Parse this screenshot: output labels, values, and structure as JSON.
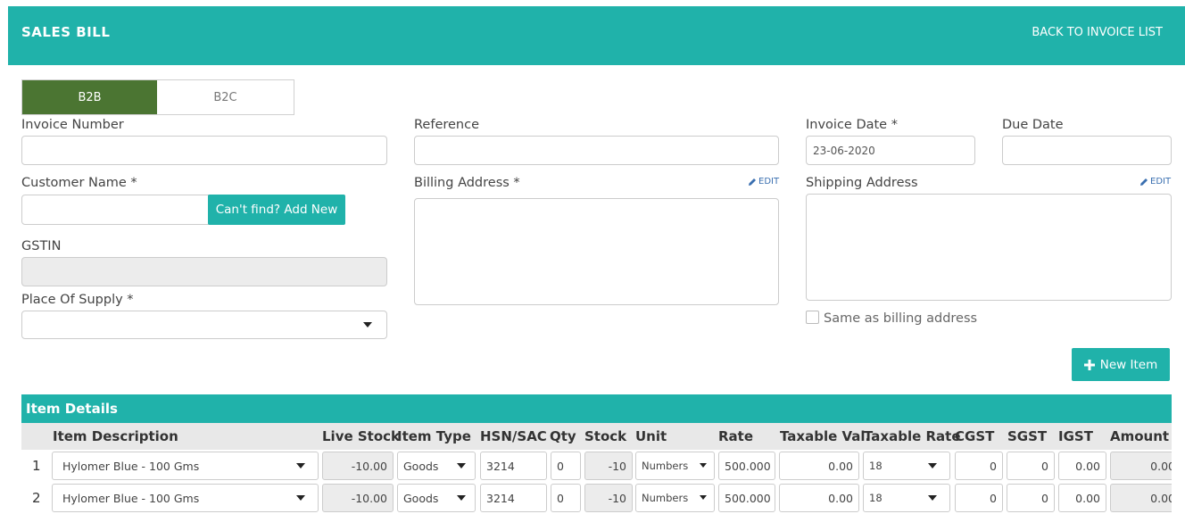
{
  "header": {
    "title": "SALES BILL",
    "back_link": "BACK TO INVOICE LIST"
  },
  "toggle": {
    "b2b": "B2B",
    "b2c": "B2C",
    "selected": "B2B",
    "active_color": "#4b7532"
  },
  "form": {
    "invoice_number": {
      "label": "Invoice Number",
      "value": ""
    },
    "reference": {
      "label": "Reference",
      "value": ""
    },
    "invoice_date": {
      "label": "Invoice Date *",
      "value": "23-06-2020"
    },
    "due_date": {
      "label": "Due Date",
      "value": ""
    },
    "customer_name": {
      "label": "Customer Name *",
      "value": "",
      "add_button": "Can't find? Add New"
    },
    "billing_address": {
      "label": "Billing Address *",
      "edit": "EDIT",
      "value": ""
    },
    "shipping_address": {
      "label": "Shipping Address",
      "edit": "EDIT",
      "value": ""
    },
    "gstin": {
      "label": "GSTIN",
      "value": ""
    },
    "place_of_supply": {
      "label": "Place Of Supply *",
      "value": ""
    },
    "same_as_billing": {
      "label": "Same as billing address",
      "checked": false
    }
  },
  "new_item_button": "New Item",
  "item_details": {
    "title": "Item Details",
    "columns": [
      "Item Description",
      "Live Stock",
      "Item Type",
      "HSN/SAC",
      "Qty",
      "Stock",
      "Unit",
      "Rate",
      "Taxable Val.",
      "Taxable Rate",
      "CGST",
      "SGST",
      "IGST",
      "Amount"
    ],
    "rows": [
      {
        "num": "1",
        "description": "Hylomer Blue - 100 Gms",
        "live_stock": "-10.00",
        "item_type": "Goods",
        "hsn": "3214",
        "qty": "0",
        "stock": "-10",
        "unit": "Numbers",
        "rate": "500.000",
        "taxable_val": "0.00",
        "taxable_rate": "18",
        "cgst": "0",
        "sgst": "0",
        "igst": "0.00",
        "amount": "0.00"
      },
      {
        "num": "2",
        "description": "Hylomer Blue - 100 Gms",
        "live_stock": "-10.00",
        "item_type": "Goods",
        "hsn": "3214",
        "qty": "0",
        "stock": "-10",
        "unit": "Numbers",
        "rate": "500.000",
        "taxable_val": "0.00",
        "taxable_rate": "18",
        "cgst": "0",
        "sgst": "0",
        "igst": "0.00",
        "amount": "0.00"
      }
    ]
  },
  "colors": {
    "teal": "#20b2aa",
    "green": "#4b7532"
  }
}
